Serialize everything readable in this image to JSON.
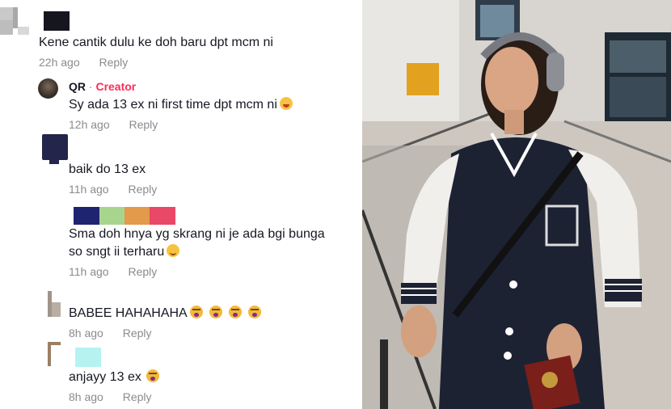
{
  "comments": [
    {
      "text": "Kene cantik dulu ke doh baru dpt mcm ni",
      "time": "22h ago",
      "reply": "Reply"
    },
    {
      "name": "QR",
      "separator": " · ",
      "badge": "Creator",
      "text": "Sy ada 13 ex ni first time dpt mcm ni",
      "time": "12h ago",
      "reply": "Reply"
    },
    {
      "text": "baik do 13 ex",
      "time": "11h ago",
      "reply": "Reply"
    },
    {
      "text_line1": "Sma doh hnya yg skrang ni je ada bgi bunga",
      "text_line2": "so sngt ii terharu",
      "time": "11h ago",
      "reply": "Reply"
    },
    {
      "text": "BABEE HAHAHAHA",
      "time": "8h ago",
      "reply": "Reply"
    },
    {
      "text": "anjayy 13 ex",
      "time": "8h ago",
      "reply": "Reply"
    }
  ],
  "emojis": [
    "laughing-emoji",
    "crying-emoji",
    "smiling-emoji"
  ],
  "colors": {
    "creator_badge": "#fe2c55",
    "meta_gray": "#8a8b91",
    "redact_blue": "#1e2470",
    "redact_green": "#a8d58e",
    "redact_orange": "#e39a4a",
    "redact_pink": "#e94866",
    "redact_cyan": "#b6f3f0"
  }
}
